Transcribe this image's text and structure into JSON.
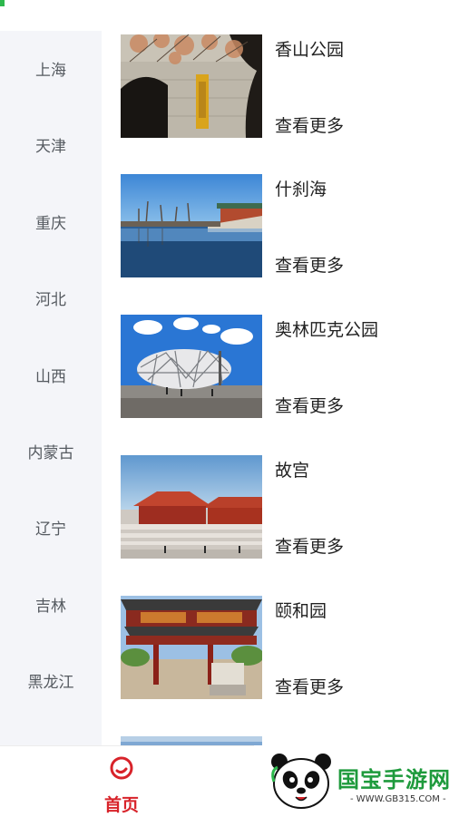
{
  "sidebar": {
    "items": [
      {
        "label": "上海"
      },
      {
        "label": "天津"
      },
      {
        "label": "重庆"
      },
      {
        "label": "河北"
      },
      {
        "label": "山西"
      },
      {
        "label": "内蒙古"
      },
      {
        "label": "辽宁"
      },
      {
        "label": "吉林"
      },
      {
        "label": "黑龙江"
      }
    ]
  },
  "attractions": [
    {
      "title": "香山公园",
      "more": "查看更多"
    },
    {
      "title": "什刹海",
      "more": "查看更多"
    },
    {
      "title": "奥林匹克公园",
      "more": "查看更多"
    },
    {
      "title": "故宫",
      "more": "查看更多"
    },
    {
      "title": "颐和园",
      "more": "查看更多"
    }
  ],
  "bottom_nav": {
    "home_label": "首页",
    "active_color": "#d8232a"
  },
  "watermark": {
    "brand": "国宝手游网",
    "url": "- WWW.GB315.COM -"
  },
  "colors": {
    "accent_green": "#2db84d",
    "sidebar_bg": "#f4f5f9"
  }
}
